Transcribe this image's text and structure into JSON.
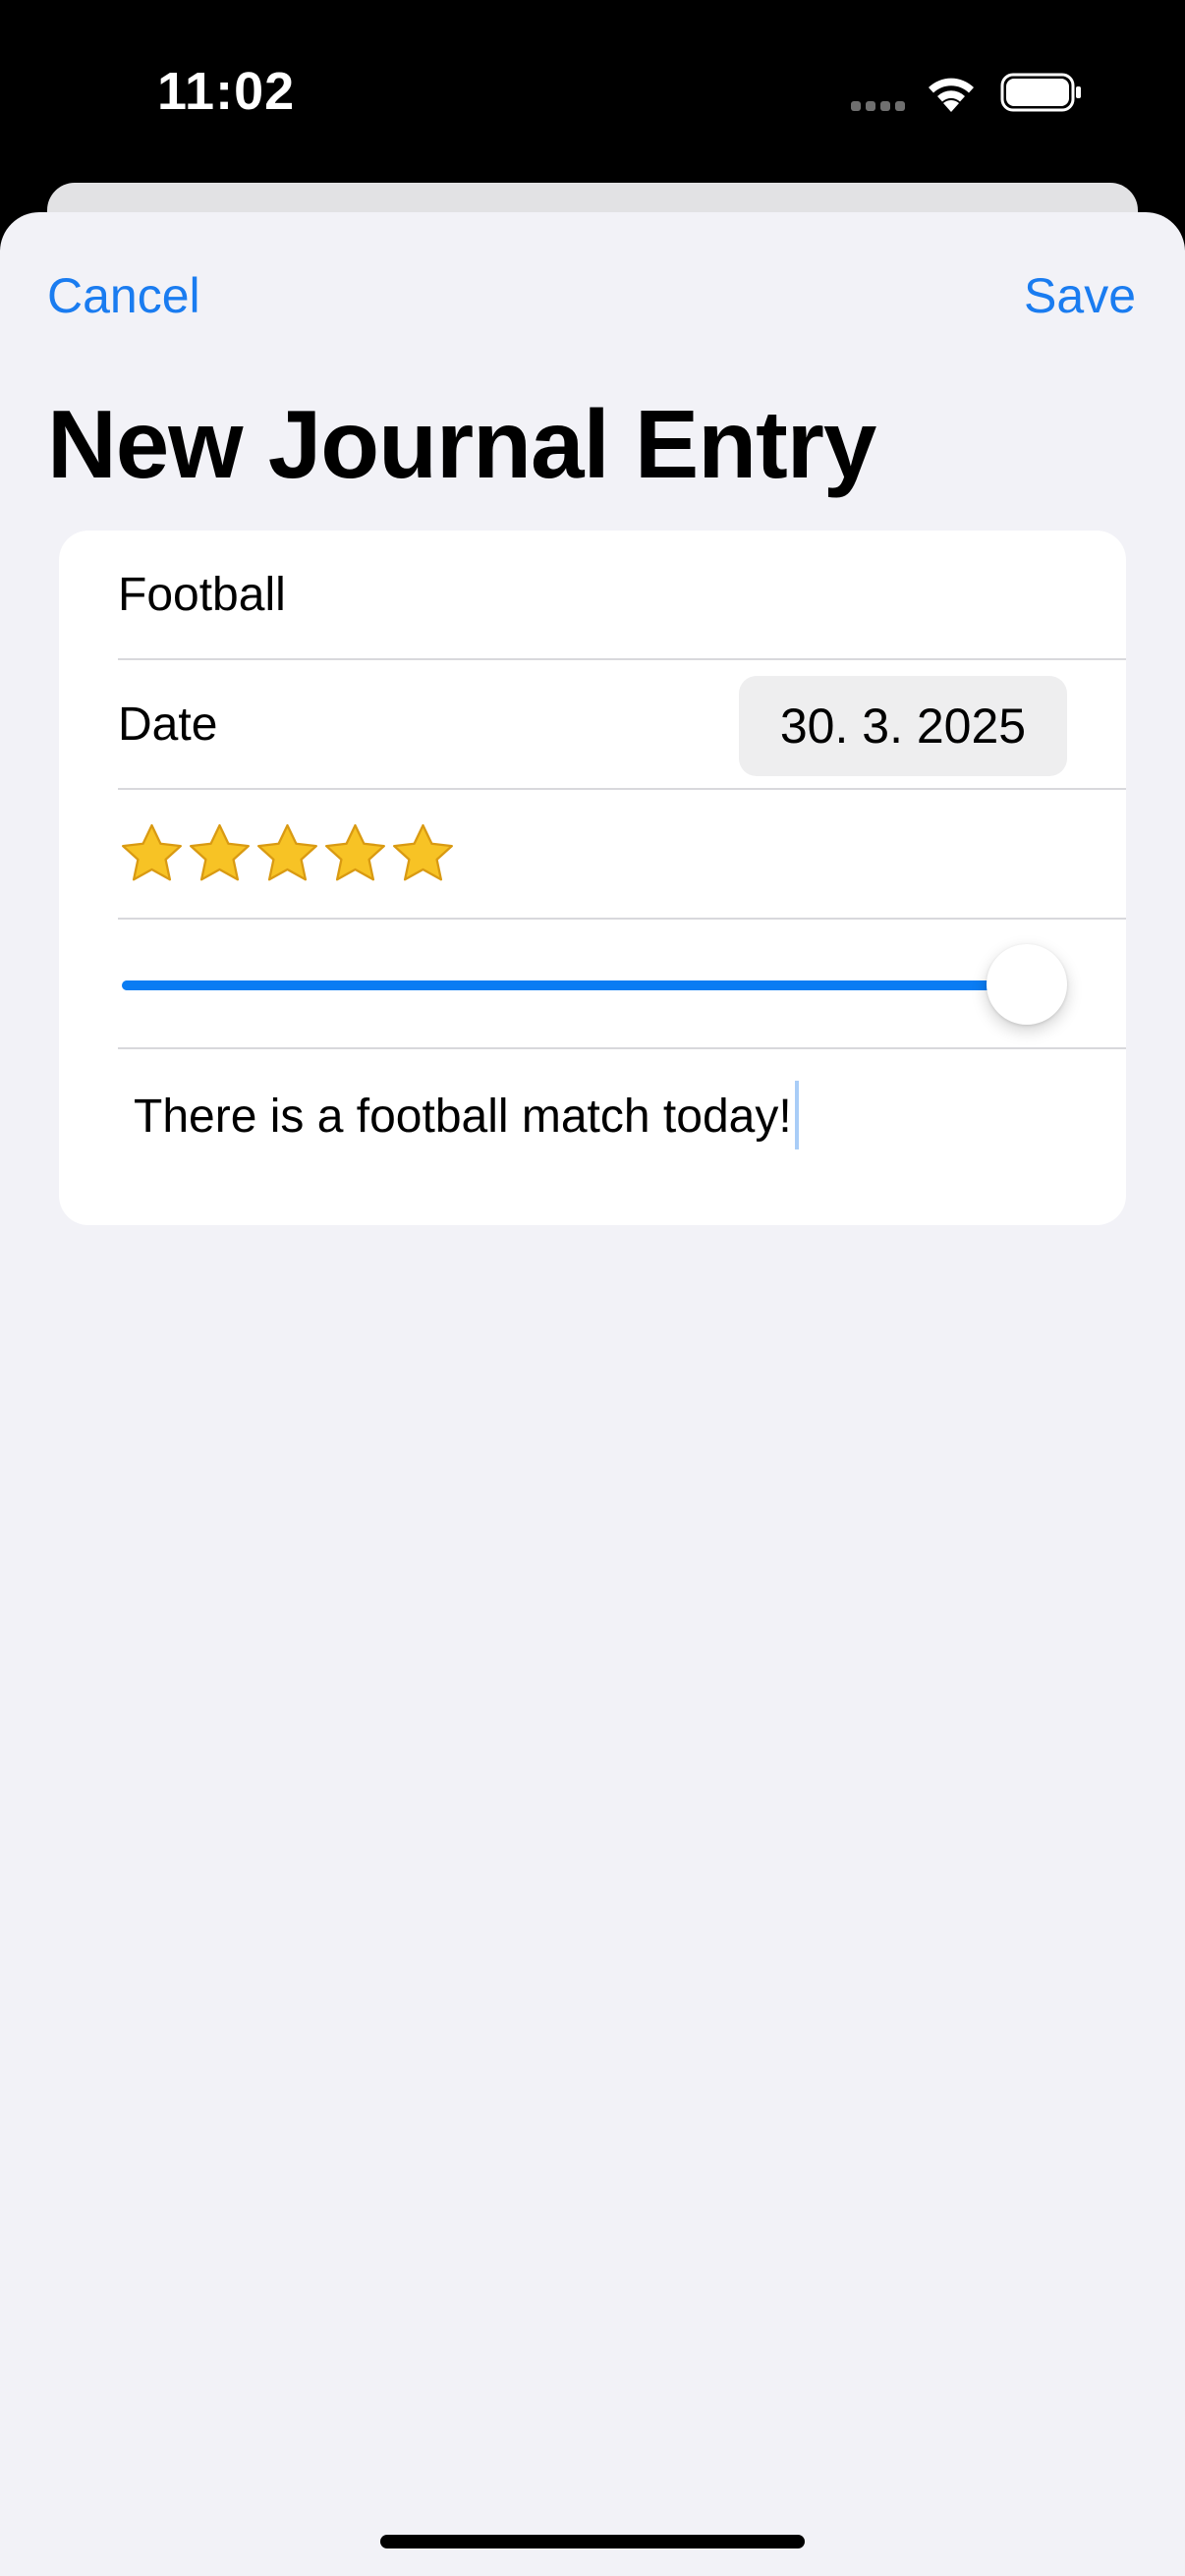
{
  "status_bar": {
    "time": "11:02"
  },
  "nav": {
    "cancel_label": "Cancel",
    "save_label": "Save"
  },
  "page": {
    "title": "New Journal Entry"
  },
  "form": {
    "title_value": "Football",
    "date_label": "Date",
    "date_value": "30. 3. 2025",
    "rating_stars": 5,
    "slider_value_fraction": 1.0,
    "notes_value": "There is a football match today!"
  },
  "colors": {
    "accent": "#1a7cf0",
    "sheet_background": "#f2f2f7",
    "card_background": "#ffffff",
    "star": "#f7c325"
  },
  "icons": {
    "wifi": "wifi-icon",
    "battery": "battery-icon",
    "signal": "signal-dots-icon",
    "star": "star-icon"
  }
}
